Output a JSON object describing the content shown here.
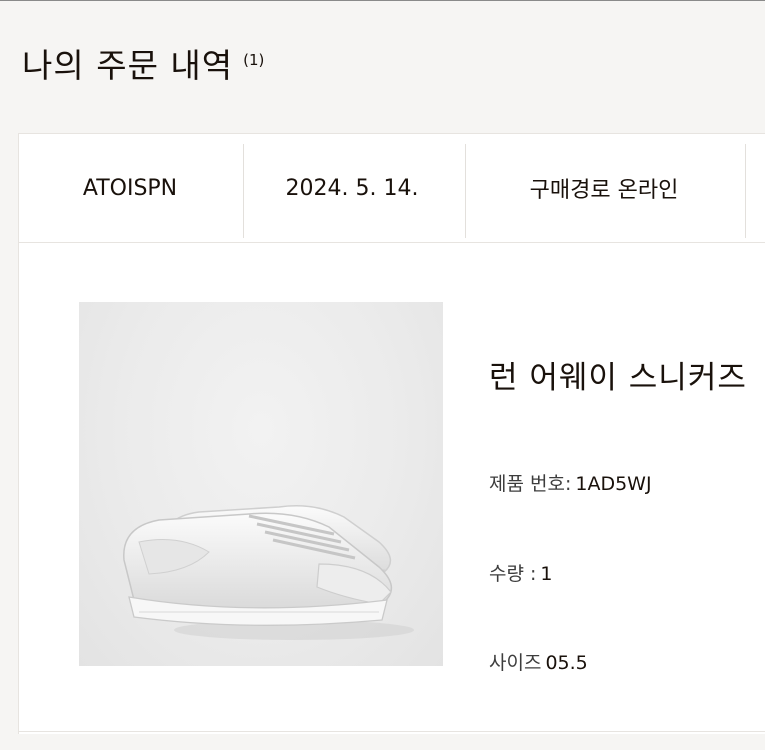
{
  "page": {
    "title": "나의 주문 내역",
    "count": "(1)"
  },
  "order": {
    "number": "ATOISPN",
    "date": "2024. 5. 14.",
    "channel": "구매경로 온라인"
  },
  "product": {
    "name": "런 어웨이 스니커즈",
    "image_icon": "sneaker-image",
    "code_label": "제품 번호:",
    "code_value": "1AD5WJ",
    "qty_label": "수량 :",
    "qty_value": "1",
    "size_label": "사이즈",
    "size_value": "05.5"
  },
  "colors": {
    "background": "#f6f5f3",
    "card": "#ffffff",
    "text": "#19110b",
    "border": "#e7e4e0"
  }
}
